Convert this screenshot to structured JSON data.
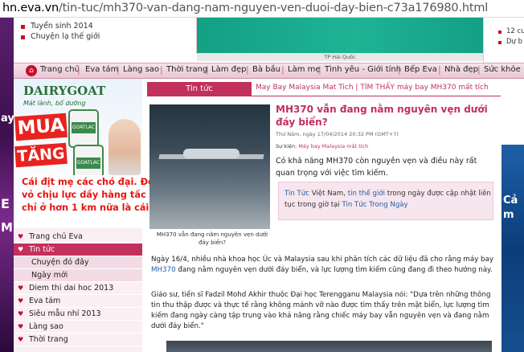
{
  "browser": {
    "url_domain": "hn.eva.vn",
    "url_path": "/tin-tuc/mh370-van-dang-nam-nguyen-ven-duoi-day-bien-c73a176980.html"
  },
  "top_left_list": [
    "Tuyển sinh 2014",
    "Chuyện lạ thế giới"
  ],
  "top_banner": {
    "location_label": "TP Hải Quốc"
  },
  "top_right_list": [
    "12 cu",
    "Dự b"
  ],
  "nav": {
    "home": "Trang chủ",
    "items": [
      "Eva tám",
      "Làng sao",
      "Thời trang",
      "Làm đẹp",
      "Bà bầu",
      "Làm mẹ",
      "Tình yêu - Giới tính",
      "Bếp Eva",
      "Nhà đẹp",
      "Sức khỏe"
    ]
  },
  "left_ad": {
    "brand": "DAIRYGOAT",
    "tagline": "Mát lành, bổ dưỡng",
    "promo1": "MUA",
    "promo2": "TĂNG",
    "can_label": "GOATLAC",
    "edge_text_top": "ay",
    "edge_text_mid": "E",
    "edge_text_bot": "M"
  },
  "left_menu": [
    {
      "label": "Trang chủ Eva",
      "active": false,
      "sub": false
    },
    {
      "label": "Tin tức",
      "active": true,
      "sub": false
    },
    {
      "label": "Chuyện đó đây",
      "active": false,
      "sub": true
    },
    {
      "label": "Ngày mới",
      "active": false,
      "sub": true
    },
    {
      "label": "Diem thi dai hoc 2013",
      "active": false,
      "sub": false
    },
    {
      "label": "Eva tám",
      "active": false,
      "sub": false
    },
    {
      "label": "Siêu mẫu nhí 2013",
      "active": false,
      "sub": false
    },
    {
      "label": "Làng sao",
      "active": false,
      "sub": false
    },
    {
      "label": "Thời trang",
      "active": false,
      "sub": false
    }
  ],
  "comment_overlay": "Cái địt mẹ các chó đại. Đến cái tàu ngầm Mỹ vỏ chịu lực dầy hàng tấc mà còn bị bóp vỡ tan chỉ ở hơn 1 km nữa là cái thùng nhôm.",
  "section_tab": "Tin tức",
  "breadcrumb": "May Bay Malaysia Mat Tich | TÌM THẤY máy bay MH370 mất tích",
  "article": {
    "title": "MH370 vẫn đang nằm nguyên vẹn dưới đáy biển?",
    "meta": "Thứ Năm, ngày 17/04/2014 20:32 PM (GMT+7)",
    "related_label": "Sự kiện:",
    "related_link": "Máy bay Malaysia mất tích",
    "lead": "Có khả năng MH370 còn nguyên vẹn và điều này rất quan trọng với việc tìm kiếm.",
    "info_box": {
      "part1": "Tin Tức",
      "part2": " Việt Nam, ",
      "part3": "tin thế giới",
      "part4": " trong ngày được cập nhật liên tục trong giờ tại ",
      "part5": "Tin Tức Trong Ngày"
    },
    "photo_caption": "MH370 vẫn đang nằm nguyên vẹn dưới đáy biển?",
    "para1_a": "Ngày 16/4, nhiều nhà khoa học Úc và Malaysia sau khi phân tích các dữ liệu đã cho rằng máy bay ",
    "para1_link": "MH370",
    "para1_b": " đang nằm nguyên vẹn dưới đáy biển, và lực lượng tìm kiếm cũng đang đi theo hướng này.",
    "para2": "Giáo sư, tiến sĩ Fadzil Mohd Akhir thuộc Đại học Terengganu Malaysia nói: \"Dựa trên những thông tin thu thập được và thực tế rằng không mảnh vỡ nào được tìm thấy trên mặt biển, lực lượng tìm kiếm đang ngày càng tập trung vào khả năng rằng chiếc máy bay vẫn nguyên vẹn và đang nằm dưới đáy biển.\""
  },
  "right_ad": {
    "text1": "Cả",
    "text2": "m"
  },
  "colors": {
    "brand_pink": "#c2305c",
    "comment_red": "#e8150f",
    "teal": "#18a989",
    "link_blue": "#1f5fa8"
  }
}
